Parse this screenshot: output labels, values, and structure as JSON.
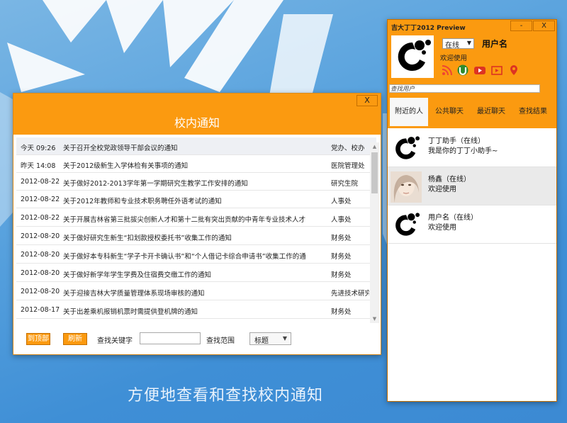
{
  "notice": {
    "close_label": "X",
    "title": "校内通知",
    "rows": [
      {
        "date": "今天 09:26",
        "title": "关于召开全校党政领导干部会议的通知",
        "dept": "党办、校办"
      },
      {
        "date": "昨天 14:08",
        "title": "关于2012级新生入学体检有关事项的通知",
        "dept": "医院管理处"
      },
      {
        "date": "2012-08-22",
        "title": "关于做好2012-2013学年第一学期研究生教学工作安排的通知",
        "dept": "研究生院"
      },
      {
        "date": "2012-08-22",
        "title": "关于2012年教师和专业技术职务聘任外语考试的通知",
        "dept": "人事处"
      },
      {
        "date": "2012-08-22",
        "title": "关于开展吉林省第三批拔尖创新人才和第十二批有突出贡献的中青年专业技术人才",
        "dept": "人事处"
      },
      {
        "date": "2012-08-20",
        "title": "关于做好研究生新生“扣划款授权委托书”收集工作的通知",
        "dept": "财务处"
      },
      {
        "date": "2012-08-20",
        "title": "关于做好本专科新生“学子卡开卡确认书”和“个人借记卡综合申请书”收集工作的通",
        "dept": "财务处"
      },
      {
        "date": "2012-08-20",
        "title": "关于做好新学年学生学费及住宿费交缴工作的通知",
        "dept": "财务处"
      },
      {
        "date": "2012-08-20",
        "title": "关于迎接吉林大学质量管理体系现场审核的通知",
        "dept": "先进技术研究"
      },
      {
        "date": "2012-08-17",
        "title": "关于出差乘机报销机票时需提供登机牌的通知",
        "dept": "财务处"
      }
    ],
    "footer": {
      "top_btn": "到顶部",
      "refresh_btn": "刷新",
      "keyword_label": "查找关键字",
      "keyword_value": "",
      "range_label": "查找范围",
      "range_value": "标题"
    }
  },
  "slogan": "方便地查看和查找校内通知",
  "im": {
    "app_title": "吉大丁丁2012 Preview",
    "minimize_label": "-",
    "close_label": "X",
    "status": "在线",
    "username": "用户名",
    "welcome": "欢迎使用",
    "icons": [
      "rss-icon",
      "utorrent-icon",
      "youtube-icon",
      "video-icon",
      "location-pin-icon"
    ],
    "search_placeholder": "查找用户",
    "tabs": [
      "附近的人",
      "公共聊天",
      "最近聊天",
      "查找结果"
    ],
    "contacts": [
      {
        "name": "丁丁助手（在线）",
        "message": "我是你的丁丁小助手~"
      },
      {
        "name": "杨鑫（在线）",
        "message": "欢迎使用"
      },
      {
        "name": "用户名（在线）",
        "message": "欢迎使用"
      }
    ]
  },
  "colors": {
    "accent": "#fb9a10",
    "background": "#4a97da"
  }
}
